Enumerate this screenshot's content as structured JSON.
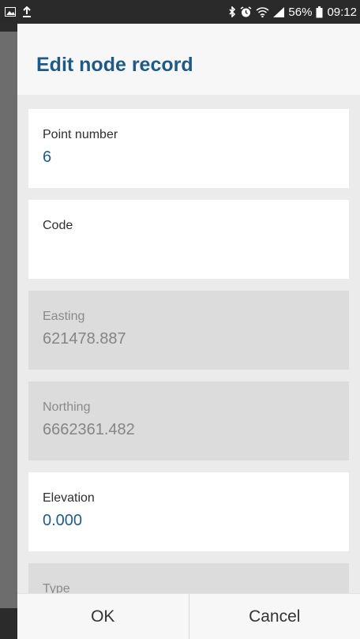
{
  "status_bar": {
    "battery_percent": "56%",
    "time": "09:12",
    "icons": [
      "gallery-icon",
      "upload-icon",
      "bluetooth-icon",
      "alarm-icon",
      "wifi-icon",
      "signal-icon",
      "battery-icon"
    ]
  },
  "dialog": {
    "title": "Edit node record",
    "fields": {
      "point_number": {
        "label": "Point number",
        "value": "6"
      },
      "code": {
        "label": "Code",
        "value": ""
      },
      "easting": {
        "label": "Easting",
        "value": "621478.887"
      },
      "northing": {
        "label": "Northing",
        "value": "6662361.482"
      },
      "elevation": {
        "label": "Elevation",
        "value": "0.000"
      },
      "type": {
        "label": "Type"
      }
    },
    "buttons": {
      "ok": "OK",
      "cancel": "Cancel"
    }
  },
  "colors": {
    "title": "#1f5a86",
    "value": "#1e5c8b",
    "readonly_bg": "#dcdcdc",
    "panel_bg": "#ebebeb"
  }
}
